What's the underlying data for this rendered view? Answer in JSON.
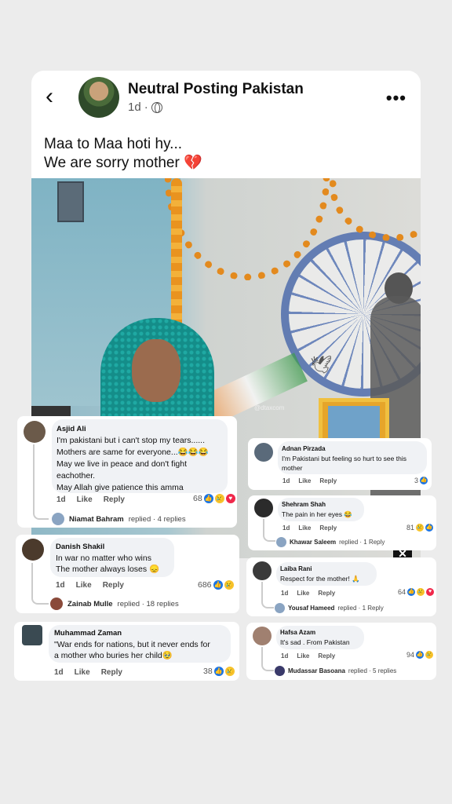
{
  "post": {
    "page_name": "Neutral Posting Pakistan",
    "time": "1d",
    "dot": "·",
    "caption_line1": "Maa to Maa hoti hy...",
    "caption_line2": "We are sorry mother",
    "heart": "💔",
    "back": "‹",
    "more": "•••",
    "icons": [
      "back-icon",
      "globe-icon",
      "more-icon",
      "broken-heart-icon"
    ]
  },
  "video": {
    "watermark": "@dtaxcom",
    "close": "✕",
    "sign_text": "ஸ"
  },
  "comments": [
    {
      "name": "Asjid Ali",
      "lines": [
        "I'm pakistani but i can't stop my tears......",
        "Mothers are same for everyone...😂😂😂",
        "May we live in peace and don't fight",
        "eachother.",
        "May Allah give patience this amma"
      ],
      "time": "1d",
      "like": "Like",
      "reply": "Reply",
      "count": "68",
      "reply_name": "Niamat Bahram",
      "reply_text": "replied · 4 replies"
    },
    {
      "name": "Danish Shakil",
      "lines": [
        "In war no matter who wins",
        "The mother always loses 😞"
      ],
      "time": "1d",
      "like": "Like",
      "reply": "Reply",
      "count": "686",
      "reply_name": "Zainab Mulle",
      "reply_text": "replied · 18 replies"
    },
    {
      "name": "Muhammad Zaman",
      "lines": [
        "\"War ends for nations, but it never ends for",
        "a mother who buries her child🥹"
      ],
      "time": "1d",
      "like": "Like",
      "reply": "Reply",
      "count": "38"
    },
    {
      "name": "Adnan Pirzada",
      "lines": [
        "I'm Pakistani but feeling so hurt to see this",
        "mother"
      ],
      "time": "1d",
      "like": "Like",
      "reply": "Reply",
      "count": "3"
    },
    {
      "name": "Shehram Shah",
      "lines": [
        "The pain in her eyes 😂"
      ],
      "time": "1d",
      "like": "Like",
      "reply": "Reply",
      "count": "81",
      "reply_name": "Khawar Saleem",
      "reply_text": "replied · 1 Reply"
    },
    {
      "name": "Laiba Rani",
      "lines": [
        "Respect for the mother! 🙏"
      ],
      "time": "1d",
      "like": "Like",
      "reply": "Reply",
      "count": "64",
      "reply_name": "Yousaf Hameed",
      "reply_text": "replied · 1 Reply"
    },
    {
      "name": "Hafsa Azam",
      "lines": [
        "It's sad . From Pakistan"
      ],
      "time": "1d",
      "like": "Like",
      "reply": "Reply",
      "count": "94",
      "reply_name": "Mudassar Basoana",
      "reply_text": "replied · 5 replies"
    }
  ]
}
